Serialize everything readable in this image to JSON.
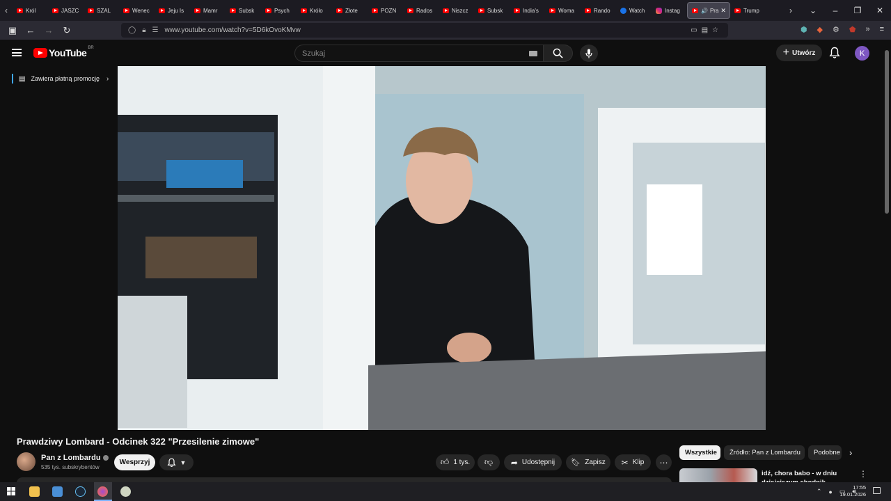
{
  "browser": {
    "tabs": [
      {
        "label": "Król",
        "favicon": "youtube-icon"
      },
      {
        "label": "JASZC",
        "favicon": "youtube-icon"
      },
      {
        "label": "SZAL",
        "favicon": "youtube-icon"
      },
      {
        "label": "Wenec",
        "favicon": "youtube-icon"
      },
      {
        "label": "Jeju Is",
        "favicon": "youtube-icon"
      },
      {
        "label": "Mamr",
        "favicon": "youtube-icon"
      },
      {
        "label": "Subsk",
        "favicon": "youtube-icon"
      },
      {
        "label": "Psych",
        "favicon": "youtube-icon"
      },
      {
        "label": "Królo",
        "favicon": "youtube-icon"
      },
      {
        "label": "Złote",
        "favicon": "youtube-icon"
      },
      {
        "label": "POZN",
        "favicon": "youtube-icon"
      },
      {
        "label": "Rados",
        "favicon": "youtube-icon"
      },
      {
        "label": "Niszcz",
        "favicon": "youtube-icon"
      },
      {
        "label": "Subsk",
        "favicon": "youtube-icon"
      },
      {
        "label": "India's",
        "favicon": "youtube-icon"
      },
      {
        "label": "Woma",
        "favicon": "youtube-icon"
      },
      {
        "label": "Rando",
        "favicon": "youtube-icon"
      },
      {
        "label": "Watch",
        "favicon": "google-icon"
      },
      {
        "label": "Instag",
        "favicon": "instagram-icon"
      }
    ],
    "active_tab": {
      "label": "Pra"
    },
    "last_tab": {
      "label": "Trump"
    },
    "url": "www.youtube.com/watch?v=5D6kOvoKMvw"
  },
  "youtube": {
    "logo_text": "YouTube",
    "country_code": "BR",
    "search_placeholder": "Szukaj",
    "create_label": "Utwórz",
    "avatar_letter": "K",
    "paid_promo_label": "Zawiera płatną promocję",
    "video": {
      "title": "Prawdziwy Lombard - Odcinek 322 \"Przesilenie zimowe\"",
      "channel_name": "Pan z Lombardu",
      "subscribers": "535 tys. subskrybentów",
      "support_label": "Wesprzyj",
      "likes": "1 tys.",
      "share_label": "Udostępnij",
      "save_label": "Zapisz",
      "clip_label": "Klip"
    },
    "chips": [
      "Wszystkie",
      "Źródło: Pan z Lombardu",
      "Podobne"
    ],
    "recommended": [
      {
        "title": "idź, chora babo - w dniu dzisiejszym chodnik nieczynn"
      }
    ]
  },
  "taskbar": {
    "time": "17:55",
    "date": "19.01.2026"
  },
  "colors": {
    "youtube_red": "#ff0000",
    "accent_blue": "#3ea6ff",
    "avatar": "#7e57c2"
  }
}
